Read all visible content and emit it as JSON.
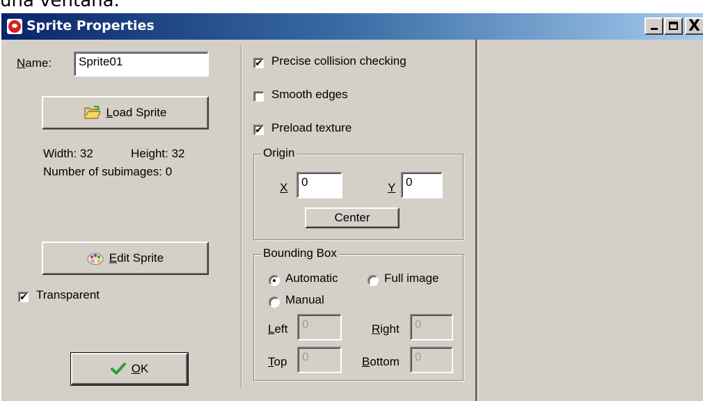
{
  "top_caption": "una ventana.",
  "window": {
    "title": "Sprite Properties",
    "buttons": {
      "minimize": "_",
      "close": "X"
    }
  },
  "left": {
    "name_label_prefix": "N",
    "name_label_rest": "ame:",
    "name_value": "Sprite01",
    "load_sprite_mnemonic": "L",
    "load_sprite_rest": "oad Sprite",
    "width_text": "Width: 32",
    "height_text": "Height: 32",
    "subimages_text": "Number of subimages: 0",
    "edit_sprite_mnemonic": "E",
    "edit_sprite_rest": "dit Sprite",
    "transparent_label": "Transparent",
    "transparent_checked": true,
    "ok_mnemonic": "O",
    "ok_rest": "K"
  },
  "middle": {
    "precise_label": "Precise collision checking",
    "precise_checked": true,
    "smooth_label": "Smooth edges",
    "smooth_checked": false,
    "preload_label": "Preload texture",
    "preload_checked": true,
    "origin": {
      "legend": "Origin",
      "x_label": "X",
      "x_value": "0",
      "y_label": "Y",
      "y_value": "0",
      "center_label": "Center"
    },
    "bbox": {
      "legend": "Bounding Box",
      "automatic_label": "Automatic",
      "full_image_label": "Full image",
      "manual_label": "Manual",
      "selected": "Automatic",
      "left_mnemonic": "L",
      "left_rest": "eft",
      "left_value": "0",
      "right_mnemonic": "R",
      "right_rest": "ight",
      "right_value": "0",
      "top_mnemonic": "T",
      "top_rest": "op",
      "top_value": "0",
      "bottom_mnemonic": "B",
      "bottom_rest": "ottom",
      "bottom_value": "0"
    }
  },
  "check_glyph": "✔",
  "colors": {
    "titlebar_start": "#0a246a",
    "titlebar_end": "#a6caf0",
    "face": "#d4d0c8",
    "ok_check": "#2e9e2e"
  }
}
